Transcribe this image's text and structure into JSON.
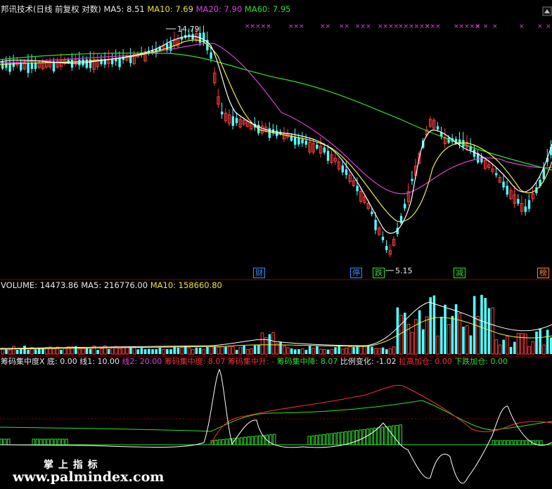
{
  "main_panel": {
    "title": "邦讯技术(日线 前复权 对数)",
    "ma5_label": "MA5:",
    "ma5_value": "8.51",
    "ma10_label": "MA10:",
    "ma10_value": "7.69",
    "ma20_label": "MA20:",
    "ma20_value": "7.90",
    "ma60_label": "MA60:",
    "ma60_value": "7.95",
    "high_annotation": "14.79",
    "low_annotation": "5.15",
    "event_markers": [
      {
        "text": "财",
        "color": "#3a8cff"
      },
      {
        "text": "停",
        "color": "#3a8cff"
      },
      {
        "text": "跌",
        "color": "#30e030"
      },
      {
        "text": "减",
        "color": "#30e030"
      },
      {
        "text": "榜",
        "color": "#ff8040"
      }
    ]
  },
  "volume_panel": {
    "label": "VOLUME:",
    "value": "14473.86",
    "ma5_label": "MA5:",
    "ma5_value": "216776.00",
    "ma10_label": "MA10:",
    "ma10_value": "158660.80"
  },
  "indicator_panel": {
    "name": "筹码集中度X",
    "base_label": "底:",
    "base_value": "0.00",
    "line1_label": "线1:",
    "line1_value": "10.00",
    "line2_label": "线2:",
    "line2_value": "20.00",
    "conc_label": "筹码集中度:",
    "conc_value": "8.07",
    "rise_label": "筹码集中升:",
    "rise_value": "-",
    "fall_label": "筹码集中降:",
    "fall_value": "8.07",
    "ratio_label": "比例变化:",
    "ratio_value": "-1.02",
    "pullup_label": "拉高加仓:",
    "pullup_value": "0.00",
    "drop_label": "下跌加仓:",
    "drop_value": "0.00"
  },
  "watermark": {
    "line1": "掌 上 指 标",
    "line2": "www.palmindex.com"
  },
  "colors": {
    "up": "#ff3c3c",
    "down": "#54ffff",
    "ma5": "#ffffff",
    "ma10": "#f0f040",
    "ma20": "#e040e0",
    "ma60": "#30e030",
    "grid": "#8b0000"
  },
  "chart_data": [
    {
      "type": "candlestick",
      "title": "邦讯技术(日线 前复权 对数)",
      "scale": "log",
      "series": [
        {
          "name": "MA5",
          "last": 8.51
        },
        {
          "name": "MA10",
          "last": 7.69
        },
        {
          "name": "MA20",
          "last": 7.9
        },
        {
          "name": "MA60",
          "last": 7.95
        }
      ],
      "annotations": [
        {
          "text": "14.79",
          "kind": "high"
        },
        {
          "text": "5.15",
          "kind": "low"
        }
      ]
    },
    {
      "type": "bar",
      "title": "VOLUME",
      "series": [
        {
          "name": "VOLUME",
          "last": 14473.86
        },
        {
          "name": "MA5",
          "last": 216776.0
        },
        {
          "name": "MA10",
          "last": 158660.8
        }
      ]
    },
    {
      "type": "line",
      "title": "筹码集中度X",
      "series": [
        {
          "name": "底",
          "last": 0.0
        },
        {
          "name": "线1",
          "last": 10.0
        },
        {
          "name": "线2",
          "last": 20.0
        },
        {
          "name": "筹码集中度",
          "last": 8.07
        },
        {
          "name": "筹码集中降",
          "last": 8.07
        },
        {
          "name": "比例变化",
          "last": -1.02
        },
        {
          "name": "拉高加仓",
          "last": 0.0
        },
        {
          "name": "下跌加仓",
          "last": 0.0
        }
      ]
    }
  ]
}
